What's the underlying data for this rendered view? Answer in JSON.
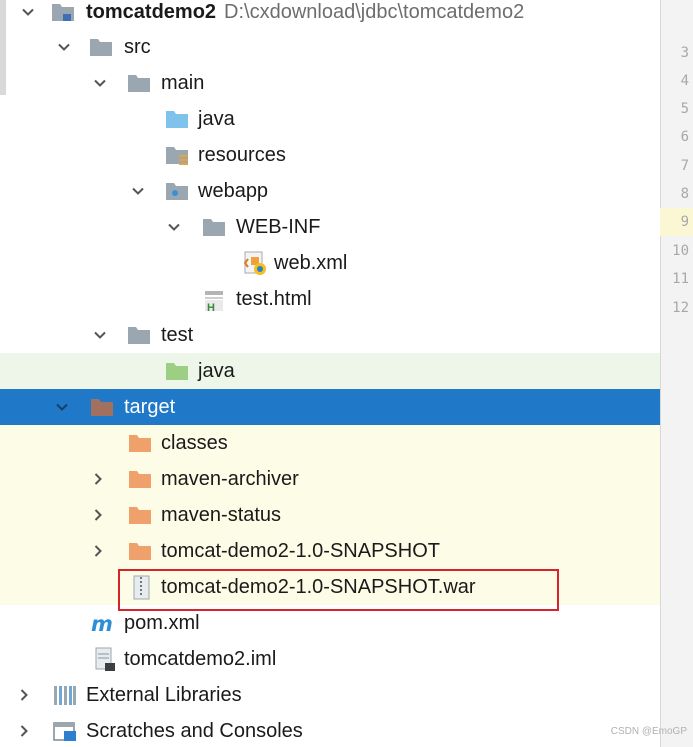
{
  "tree": {
    "rows": [
      {
        "label": "tomcatdemo2",
        "path": "D:\\cxdownload\\jdbc\\tomcatdemo2"
      },
      {
        "label": "src"
      },
      {
        "label": "main"
      },
      {
        "label": "java"
      },
      {
        "label": "resources"
      },
      {
        "label": "webapp"
      },
      {
        "label": "WEB-INF"
      },
      {
        "label": "web.xml"
      },
      {
        "label": "test.html"
      },
      {
        "label": "test"
      },
      {
        "label": "java"
      },
      {
        "label": "target"
      },
      {
        "label": "classes"
      },
      {
        "label": "maven-archiver"
      },
      {
        "label": "maven-status"
      },
      {
        "label": "tomcat-demo2-1.0-SNAPSHOT"
      },
      {
        "label": "tomcat-demo2-1.0-SNAPSHOT.war"
      },
      {
        "label": "pom.xml"
      },
      {
        "label": "tomcatdemo2.iml"
      },
      {
        "label": "External Libraries"
      },
      {
        "label": "Scratches and Consoles"
      }
    ]
  },
  "gutter": {
    "line_numbers": [
      "3",
      "4",
      "5",
      "6",
      "7",
      "8",
      "9",
      "10",
      "11",
      "12"
    ],
    "current_line": "9"
  },
  "watermark": "CSDN @EmoGP",
  "colors": {
    "selection": "#1f78c8",
    "highlight_box": "#d7232b",
    "folder_gray": "#9aa7b0",
    "folder_orange": "#f0a16b",
    "folder_blue": "#7fc2ec",
    "folder_green": "#9ccf84",
    "folder_brown": "#a1705f"
  }
}
